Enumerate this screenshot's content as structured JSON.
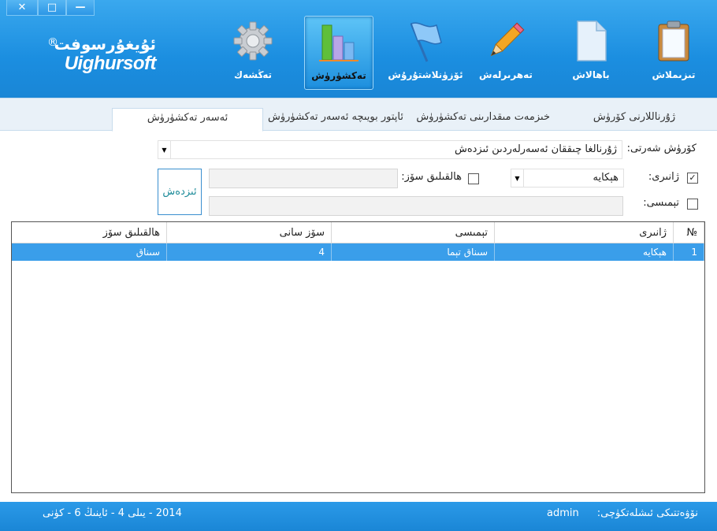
{
  "window_controls": {
    "close": "✕",
    "maximize": "□",
    "minimize": "—"
  },
  "brand": {
    "uyghur": "ئۇيغۇرسوفت",
    "latin": "Uighursoft",
    "reg": "®"
  },
  "toolbar": [
    {
      "id": "settings",
      "label": "تەڭشەك",
      "icon": "gear-icon"
    },
    {
      "id": "statistics",
      "label": "تەكشۈرۈش",
      "icon": "bar-chart-icon",
      "active": true
    },
    {
      "id": "registration",
      "label": "ئۆزۈنلاشتۇرۇش",
      "icon": "flag-icon"
    },
    {
      "id": "editing",
      "label": "تەھرىرلەش",
      "icon": "pencil-icon"
    },
    {
      "id": "evaluation",
      "label": "باھالاش",
      "icon": "document-icon"
    },
    {
      "id": "catalog",
      "label": "تىزىملاش",
      "icon": "clipboard-icon"
    }
  ],
  "tabs": [
    {
      "label": "ئەسەر تەكشۈرۈش",
      "active": true
    },
    {
      "label": "ئاپتور بويىچە ئەسەر تەكشۈرۈش"
    },
    {
      "label": "خىزمەت مىقدارىنى تەكشۈرۈش"
    },
    {
      "label": "ژۇرناللارنى كۆرۈش"
    }
  ],
  "form": {
    "condition_label": "كۆرۈش شەرتى:",
    "condition_value": "ژۇرنالغا چىققان ئەسەرلەردىن ئىزدەش",
    "genre_label": "ژانىرى:",
    "genre_checked": true,
    "genre_value": "ھېكايە",
    "status_label": "ھالقىلىق سۆز:",
    "status_checked": false,
    "theme_label": "تېمىسى:",
    "theme_checked": false,
    "search_button": "ئىزدەش"
  },
  "grid": {
    "columns": [
      "№",
      "ژانىرى",
      "تېمىسى",
      "سۆز سانى",
      "ھالقىلىق سۆز"
    ],
    "rows": [
      [
        "1",
        "ھېكايە",
        "سىناق تېما",
        "4",
        "سىناق"
      ]
    ]
  },
  "status": {
    "operator_label": "نۆۋەتتىكى ئىشلەتكۈچى:",
    "operator_value": "admin",
    "date": "2014 - يىلى 4 - ئاينىڭ 6 - كۈنى"
  },
  "colors": {
    "header": "#1b8ee0",
    "selection": "#3a9eea",
    "status": "#1a86d6"
  }
}
